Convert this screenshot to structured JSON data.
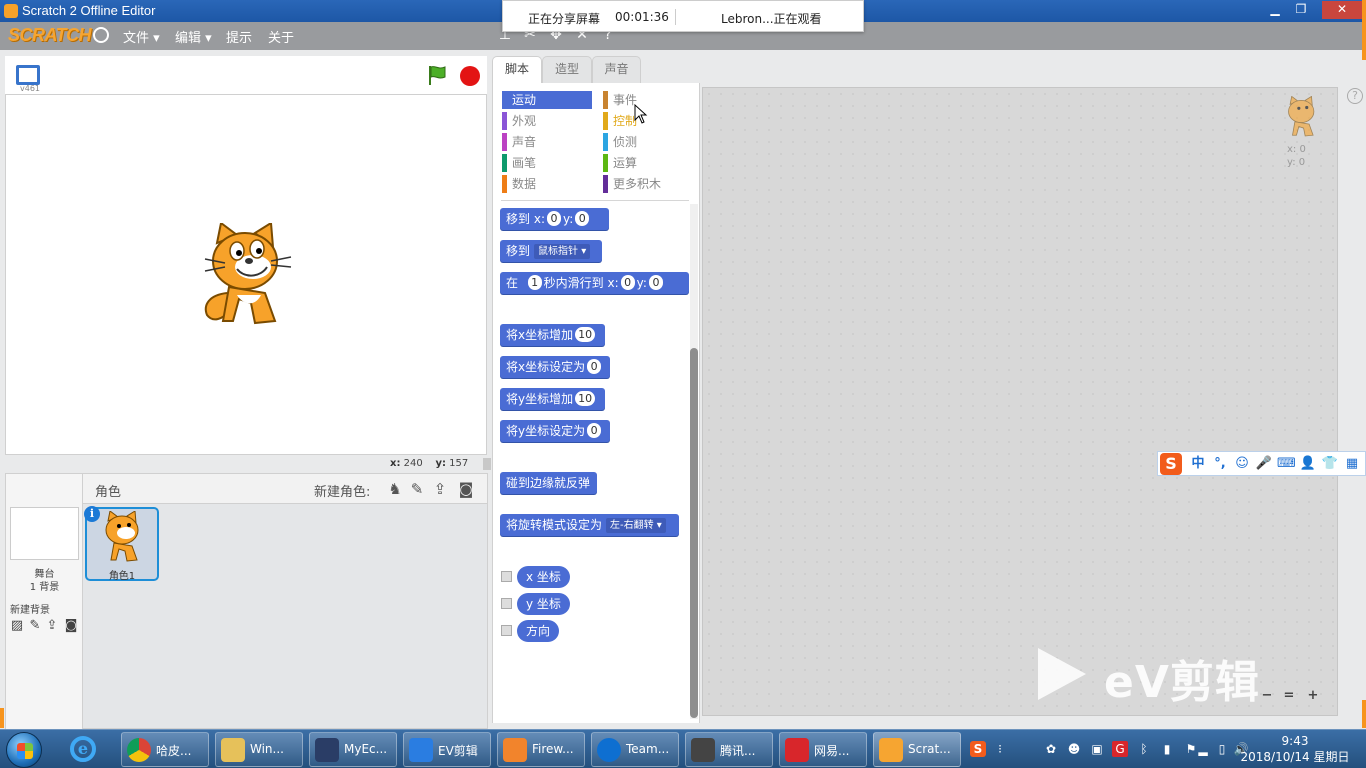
{
  "window": {
    "title": "Scratch 2 Offline Editor",
    "controls": [
      "minimize",
      "maximize",
      "close"
    ]
  },
  "menubar": {
    "logo": "SCRATCH",
    "items": [
      "文件 ▾",
      "编辑 ▾",
      "提示",
      "关于"
    ],
    "tools": [
      "duplicate-stamp-icon",
      "delete-cut-icon",
      "grow-icon",
      "shrink-icon",
      "help-question-icon"
    ]
  },
  "share_overlay": {
    "status": "正在分享屏幕",
    "timer": "00:01:36",
    "viewers": "Lebron...正在观看"
  },
  "stage": {
    "version": "v461",
    "mouse_x_label": "x:",
    "mouse_x": "240",
    "mouse_y_label": "y:",
    "mouse_y": "157"
  },
  "sprite_panel": {
    "title": "角色",
    "new_sprite_label": "新建角色:",
    "stage_label": "舞台",
    "stage_backdrops": "1 背景",
    "new_backdrop_label": "新建背景",
    "sprites": [
      {
        "name": "角色1",
        "info": "i"
      }
    ]
  },
  "tabs": [
    "脚本",
    "造型",
    "声音"
  ],
  "categories": [
    {
      "label": "运动",
      "color": "#4a6cd4",
      "active": true
    },
    {
      "label": "事件",
      "color": "#c88330"
    },
    {
      "label": "外观",
      "color": "#8a55d7"
    },
    {
      "label": "控制",
      "color": "#e1a91a"
    },
    {
      "label": "声音",
      "color": "#bb42c3"
    },
    {
      "label": "侦测",
      "color": "#2ca5e2"
    },
    {
      "label": "画笔",
      "color": "#0e9a6c"
    },
    {
      "label": "运算",
      "color": "#5cb712"
    },
    {
      "label": "数据",
      "color": "#ee7d16"
    },
    {
      "label": "更多积木",
      "color": "#632d99"
    }
  ],
  "blocks": {
    "goto_xy": {
      "label": "移到",
      "x_label": "x:",
      "x": "0",
      "y_label": "y:",
      "y": "0"
    },
    "goto_target": {
      "label": "移到",
      "target": "鼠标指针"
    },
    "glide": {
      "label_in": "在",
      "secs": "1",
      "label_secs": "秒内滑行到",
      "x_label": "x:",
      "x": "0",
      "y_label": "y:",
      "y": "0"
    },
    "change_x": {
      "label": "将x坐标增加",
      "value": "10"
    },
    "set_x": {
      "label": "将x坐标设定为",
      "value": "0"
    },
    "change_y": {
      "label": "将y坐标增加",
      "value": "10"
    },
    "set_y": {
      "label": "将y坐标设定为",
      "value": "0"
    },
    "bounce": {
      "label": "碰到边缘就反弹"
    },
    "rotation_style": {
      "label": "将旋转模式设定为",
      "value": "左-右翻转"
    },
    "reporters": [
      "x 坐标",
      "y 坐标",
      "方向"
    ]
  },
  "script_area": {
    "sprite_x_label": "x:",
    "sprite_x": "0",
    "sprite_y_label": "y:",
    "sprite_y": "0",
    "help": "?"
  },
  "watermark": {
    "text": "eV剪辑"
  },
  "ime": {
    "items": [
      "中",
      "°,",
      "☺",
      "🎤",
      "⌨",
      "👤",
      "👕",
      "▦"
    ]
  },
  "taskbar": {
    "items": [
      {
        "label": "哈皮...",
        "color": "#f5c431"
      },
      {
        "label": "Win...",
        "color": "#e6c15a"
      },
      {
        "label": "MyEc...",
        "color": "#2a3d66"
      },
      {
        "label": "EV剪辑",
        "color": "#2a7de1"
      },
      {
        "label": "Firew...",
        "color": "#f2842c"
      },
      {
        "label": "Team...",
        "color": "#0e6fd1"
      },
      {
        "label": "腾讯...",
        "color": "#444444"
      },
      {
        "label": "网易...",
        "color": "#d8262b"
      },
      {
        "label": "Scrat...",
        "color": "#f6a531"
      }
    ],
    "time": "9:43",
    "date": "2018/10/14 星期日"
  }
}
